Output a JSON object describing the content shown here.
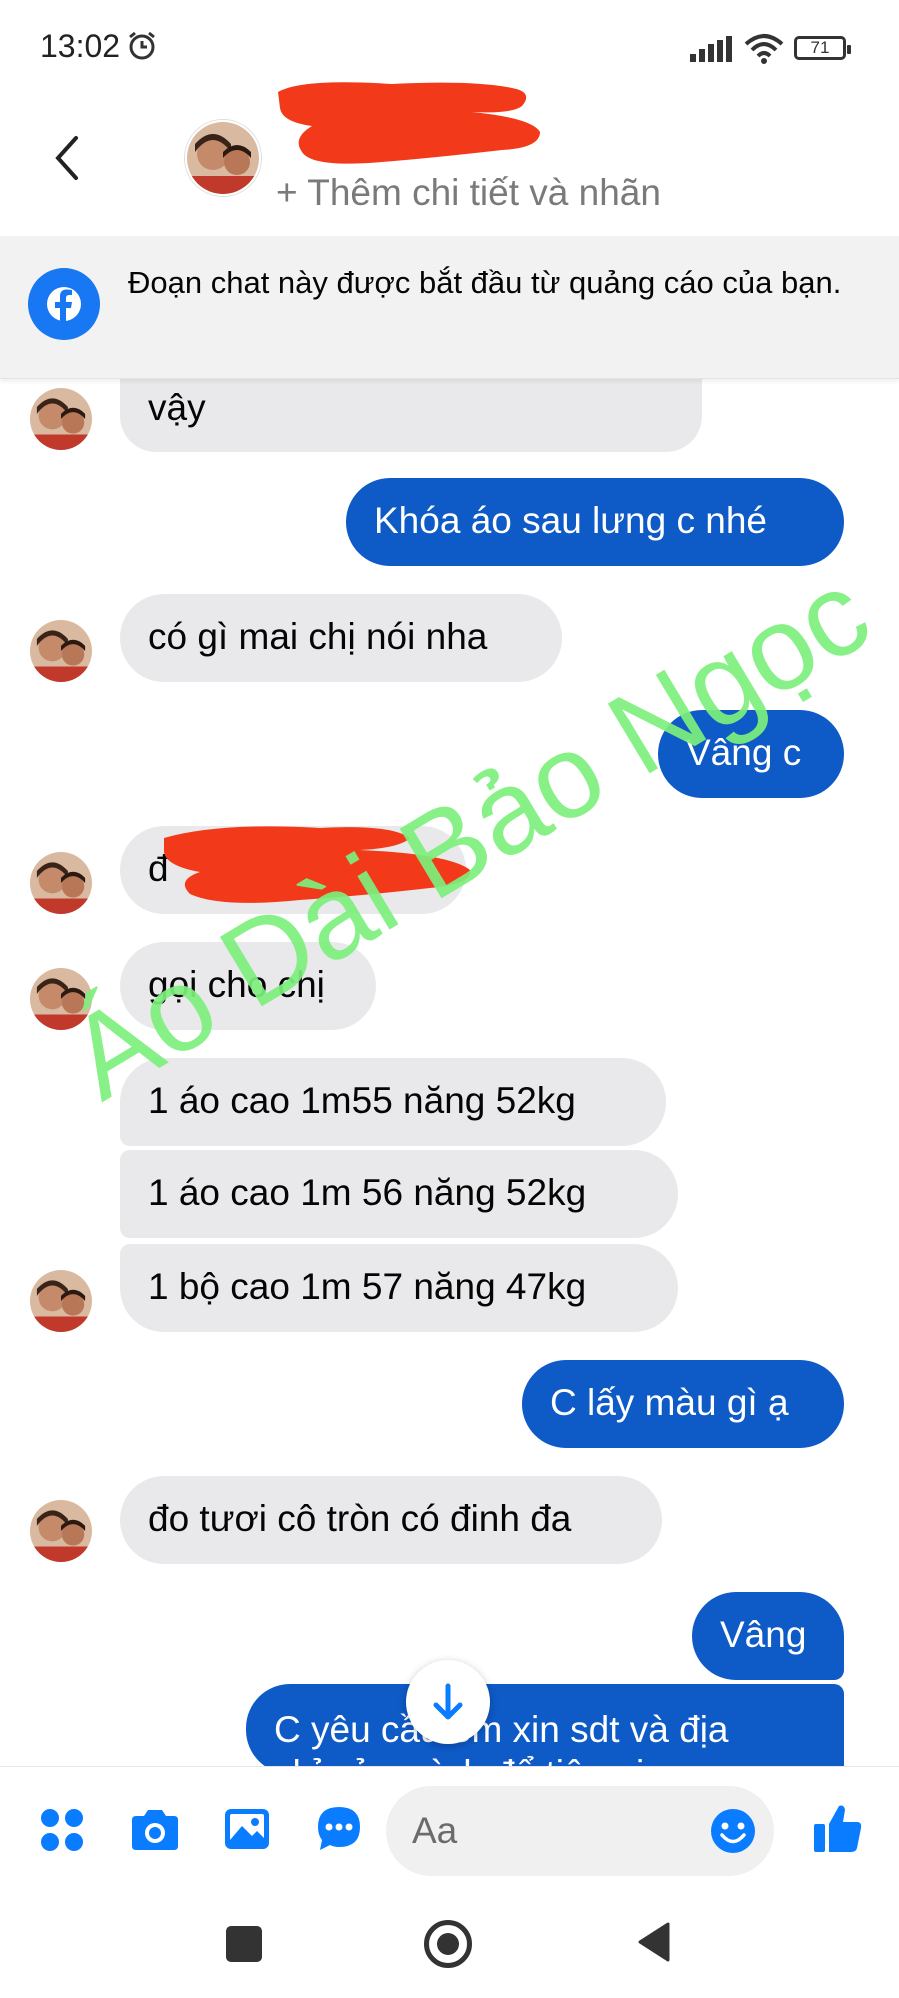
{
  "status_bar": {
    "time": "13:02",
    "battery": "71"
  },
  "header": {
    "add_details": "+ Thêm chi tiết và nhãn"
  },
  "banner": {
    "text": "Đoạn chat này được bắt đầu từ quảng cáo của bạn."
  },
  "messages": [
    {
      "side": "in",
      "text": "vậy"
    },
    {
      "side": "out",
      "text": "Khóa áo sau lưng c nhé"
    },
    {
      "side": "in",
      "text": "có gì mai chị nói nha"
    },
    {
      "side": "out",
      "text": "Vâng c"
    },
    {
      "side": "in",
      "text": "đ"
    },
    {
      "side": "in",
      "text": "gọi cho chị"
    },
    {
      "side": "in",
      "text": "1 áo cao 1m55 năng 52kg"
    },
    {
      "side": "in",
      "text": "1 áo cao 1m 56 năng 52kg"
    },
    {
      "side": "in",
      "text": "1 bộ cao 1m 57 năng 47kg"
    },
    {
      "side": "out",
      "text": "C lấy màu gì ạ"
    },
    {
      "side": "in",
      "text": "đo tươi cô tròn có đinh đa"
    },
    {
      "side": "out",
      "text": "Vâng"
    },
    {
      "side": "out",
      "text": "C yêu cầu em xin sdt và địa",
      "text_line2": "chỉ của mình để tiện giao"
    }
  ],
  "watermark": "Áo Dài Bảo Ngọc",
  "composer": {
    "placeholder": "Aa"
  },
  "colors": {
    "outgoing_bubble": "#0e5ac7",
    "incoming_bubble": "#e9e9eb",
    "accent": "#1877f2",
    "watermark": "#7df07d",
    "redaction": "#f23a1a"
  },
  "icons": [
    "alarm-icon",
    "signal-icon",
    "wifi-icon",
    "back-icon",
    "facebook-icon",
    "apps-icon",
    "camera-icon",
    "gallery-icon",
    "chat-icon",
    "emoji-icon",
    "like-icon",
    "arrow-down-icon"
  ]
}
